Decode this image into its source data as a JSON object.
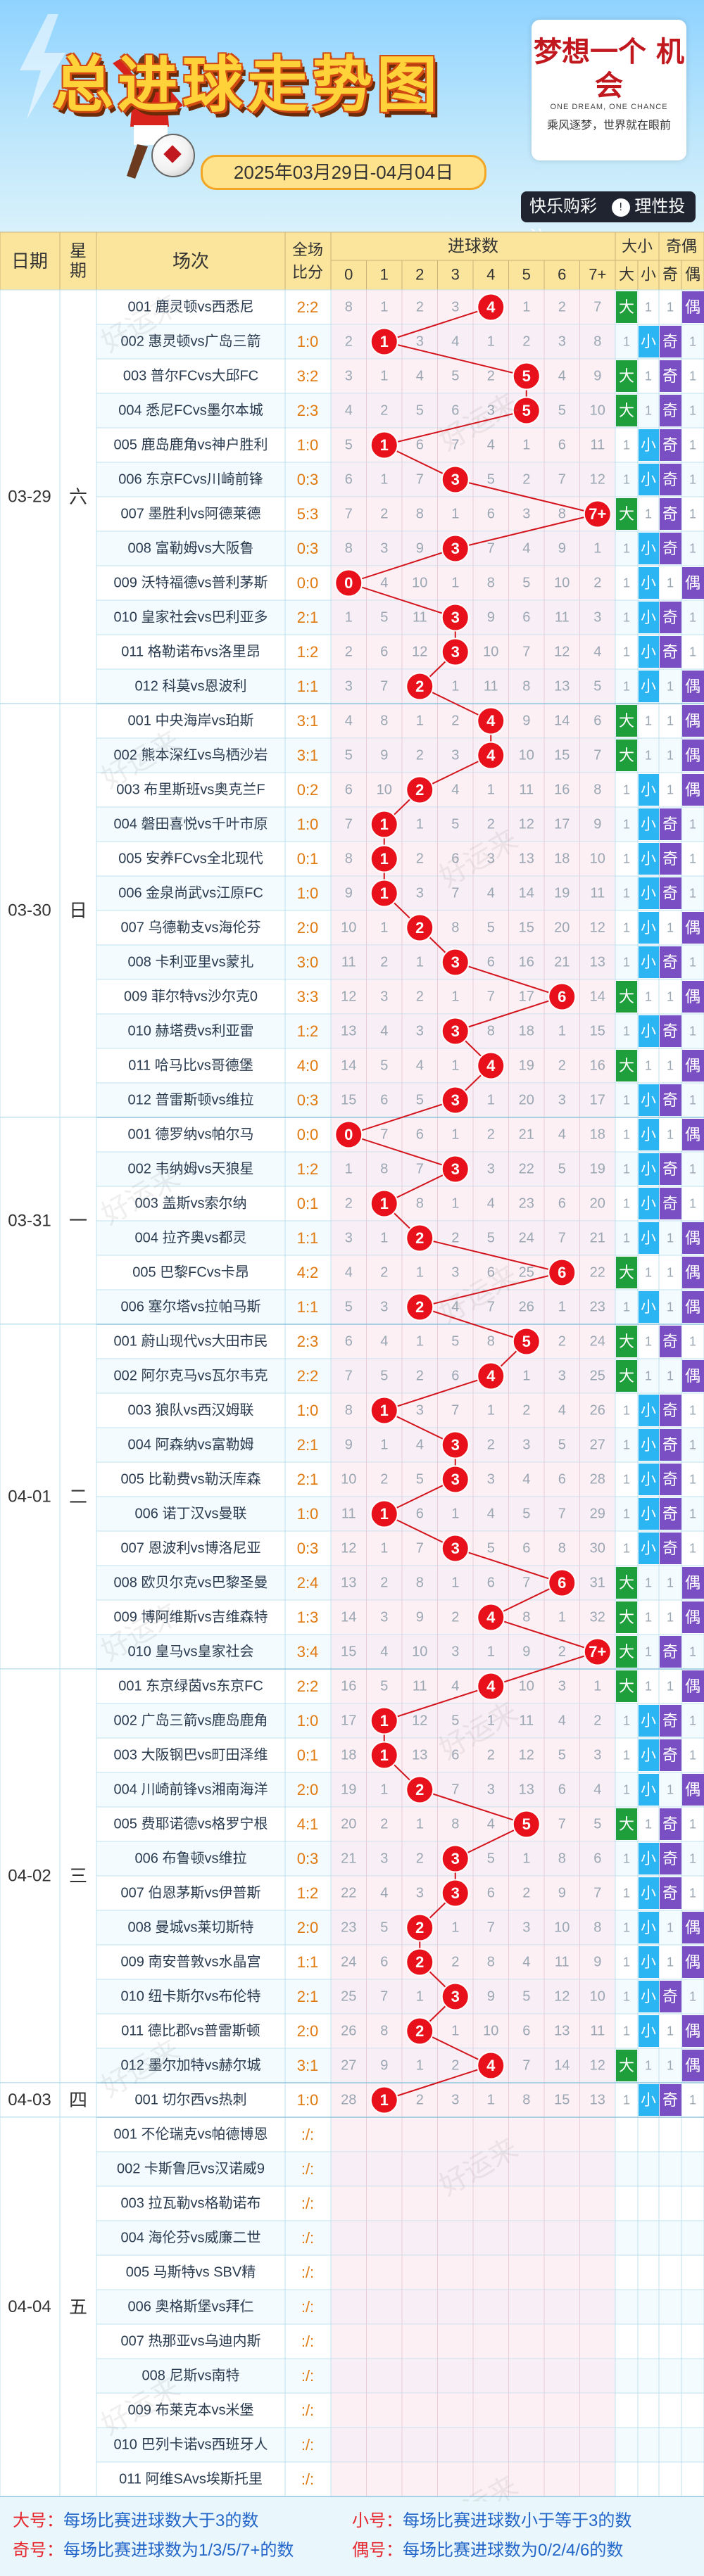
{
  "banner": {
    "title": "总进球走势图",
    "date_range": "2025年03月29日-04月04日",
    "slogan_main": "梦想一个 机会",
    "slogan_en": "ONE DREAM, ONE CHANCE",
    "slogan_cn": "乘风逐梦，世界就在眼前",
    "brand_1": "快乐购彩",
    "brand_2": "理性投注",
    "brand_icon": "!"
  },
  "header": {
    "date": "日期",
    "weekday": "星期",
    "match": "场次",
    "score_top": "全场",
    "score_bottom": "比分",
    "goals": "进球数",
    "goal_cols": [
      "0",
      "1",
      "2",
      "3",
      "4",
      "5",
      "6",
      "7+"
    ],
    "bigsmall": "大小",
    "big": "大",
    "small": "小",
    "oddeven": "奇偶",
    "odd": "奇",
    "even": "偶"
  },
  "watermark": "好运来",
  "colors": {
    "header_bg": "#fbe59c",
    "big": "#1f9e3c",
    "small": "#2bb5f2",
    "odd": "#7a4fc4",
    "even": "#7a4fc4",
    "ball": "#e8101a",
    "line": "#d4141c",
    "tint": "#fbe3ec"
  },
  "chart_data": {
    "type": "table",
    "days": [
      {
        "date": "03-29",
        "weekday": "六",
        "matches": [
          {
            "name": "001 鹿灵顿vs西悉尼",
            "score": "2:2",
            "goals": 4,
            "omit": [
              8,
              1,
              2,
              3,
              null,
              1,
              2,
              7
            ]
          },
          {
            "name": "002 惠灵顿vs广岛三箭",
            "score": "1:0",
            "goals": 1,
            "omit": [
              2,
              null,
              3,
              4,
              1,
              2,
              3,
              8
            ]
          },
          {
            "name": "003 普尔FCvs大邱FC",
            "score": "3:2",
            "goals": 5,
            "omit": [
              3,
              1,
              4,
              5,
              2,
              null,
              4,
              9
            ]
          },
          {
            "name": "004 悉尼FCvs墨尔本城",
            "score": "2:3",
            "goals": 5,
            "omit": [
              4,
              2,
              5,
              6,
              3,
              null,
              5,
              10
            ]
          },
          {
            "name": "005 鹿岛鹿角vs神户胜利",
            "score": "1:0",
            "goals": 1,
            "omit": [
              5,
              null,
              6,
              7,
              4,
              1,
              6,
              11
            ]
          },
          {
            "name": "006 东京FCvs川崎前锋",
            "score": "0:3",
            "goals": 3,
            "omit": [
              6,
              1,
              7,
              null,
              5,
              2,
              7,
              12
            ]
          },
          {
            "name": "007 墨胜利vs阿德莱德",
            "score": "5:3",
            "goals": 7,
            "omit": [
              7,
              2,
              8,
              1,
              6,
              3,
              8,
              null
            ]
          },
          {
            "name": "008 富勒姆vs大阪鲁",
            "score": "0:3",
            "goals": 3,
            "omit": [
              8,
              3,
              9,
              null,
              7,
              4,
              9,
              1
            ]
          },
          {
            "name": "009 沃特福德vs普利茅斯",
            "score": "0:0",
            "goals": 0,
            "omit": [
              null,
              4,
              10,
              1,
              8,
              5,
              10,
              2
            ]
          },
          {
            "name": "010 皇家社会vs巴利亚多",
            "score": "2:1",
            "goals": 3,
            "omit": [
              1,
              5,
              11,
              null,
              9,
              6,
              11,
              3
            ]
          },
          {
            "name": "011 格勒诺布vs洛里昂",
            "score": "1:2",
            "goals": 3,
            "omit": [
              2,
              6,
              12,
              null,
              10,
              7,
              12,
              4
            ]
          },
          {
            "name": "012 科莫vs恩波利",
            "score": "1:1",
            "goals": 2,
            "omit": [
              3,
              7,
              null,
              1,
              11,
              8,
              13,
              5
            ]
          }
        ]
      },
      {
        "date": "03-30",
        "weekday": "日",
        "matches": [
          {
            "name": "001 中央海岸vs珀斯",
            "score": "3:1",
            "goals": 4,
            "omit": [
              4,
              8,
              1,
              2,
              null,
              9,
              14,
              6
            ]
          },
          {
            "name": "002 熊本深红vs鸟栖沙岩",
            "score": "3:1",
            "goals": 4,
            "omit": [
              5,
              9,
              2,
              3,
              null,
              10,
              15,
              7
            ]
          },
          {
            "name": "003 布里斯班vs奥克兰F",
            "score": "0:2",
            "goals": 2,
            "omit": [
              6,
              10,
              null,
              4,
              1,
              11,
              16,
              8
            ]
          },
          {
            "name": "004 磐田喜悦vs千叶市原",
            "score": "1:0",
            "goals": 1,
            "omit": [
              7,
              null,
              1,
              5,
              2,
              12,
              17,
              9
            ]
          },
          {
            "name": "005 安养FCvs全北现代",
            "score": "0:1",
            "goals": 1,
            "omit": [
              8,
              null,
              2,
              6,
              3,
              13,
              18,
              10
            ]
          },
          {
            "name": "006 金泉尚武vs江原FC",
            "score": "1:0",
            "goals": 1,
            "omit": [
              9,
              null,
              3,
              7,
              4,
              14,
              19,
              11
            ]
          },
          {
            "name": "007 乌德勒支vs海伦芬",
            "score": "2:0",
            "goals": 2,
            "omit": [
              10,
              1,
              null,
              8,
              5,
              15,
              20,
              12
            ]
          },
          {
            "name": "008 卡利亚里vs蒙扎",
            "score": "3:0",
            "goals": 3,
            "omit": [
              11,
              2,
              1,
              null,
              6,
              16,
              21,
              13
            ]
          },
          {
            "name": "009 菲尔特vs沙尔克0",
            "score": "3:3",
            "goals": 6,
            "omit": [
              12,
              3,
              2,
              1,
              7,
              17,
              null,
              14
            ]
          },
          {
            "name": "010 赫塔费vs利亚雷",
            "score": "1:2",
            "goals": 3,
            "omit": [
              13,
              4,
              3,
              null,
              8,
              18,
              1,
              15
            ]
          },
          {
            "name": "011 哈马比vs哥德堡",
            "score": "4:0",
            "goals": 4,
            "omit": [
              14,
              5,
              4,
              1,
              null,
              19,
              2,
              16
            ]
          },
          {
            "name": "012 普雷斯顿vs维拉",
            "score": "0:3",
            "goals": 3,
            "omit": [
              15,
              6,
              5,
              null,
              1,
              20,
              3,
              17
            ]
          }
        ]
      },
      {
        "date": "03-31",
        "weekday": "一",
        "matches": [
          {
            "name": "001 德罗纳vs帕尔马",
            "score": "0:0",
            "goals": 0,
            "omit": [
              null,
              7,
              6,
              1,
              2,
              21,
              4,
              18
            ]
          },
          {
            "name": "002 韦纳姆vs天狼星",
            "score": "1:2",
            "goals": 3,
            "omit": [
              1,
              8,
              7,
              null,
              3,
              22,
              5,
              19
            ]
          },
          {
            "name": "003 盖斯vs索尔纳",
            "score": "0:1",
            "goals": 1,
            "omit": [
              2,
              null,
              8,
              1,
              4,
              23,
              6,
              20
            ]
          },
          {
            "name": "004 拉齐奥vs都灵",
            "score": "1:1",
            "goals": 2,
            "omit": [
              3,
              1,
              null,
              2,
              5,
              24,
              7,
              21
            ]
          },
          {
            "name": "005 巴黎FCvs卡昂",
            "score": "4:2",
            "goals": 6,
            "omit": [
              4,
              2,
              1,
              3,
              6,
              25,
              null,
              22
            ]
          },
          {
            "name": "006 塞尔塔vs拉帕马斯",
            "score": "1:1",
            "goals": 2,
            "omit": [
              5,
              3,
              null,
              4,
              7,
              26,
              1,
              23
            ]
          }
        ]
      },
      {
        "date": "04-01",
        "weekday": "二",
        "matches": [
          {
            "name": "001 蔚山现代vs大田市民",
            "score": "2:3",
            "goals": 5,
            "omit": [
              6,
              4,
              1,
              5,
              8,
              null,
              2,
              24
            ]
          },
          {
            "name": "002 阿尔克马vs瓦尔韦克",
            "score": "2:2",
            "goals": 4,
            "omit": [
              7,
              5,
              2,
              6,
              null,
              1,
              3,
              25
            ]
          },
          {
            "name": "003 狼队vs西汉姆联",
            "score": "1:0",
            "goals": 1,
            "omit": [
              8,
              null,
              3,
              7,
              1,
              2,
              4,
              26
            ]
          },
          {
            "name": "004 阿森纳vs富勒姆",
            "score": "2:1",
            "goals": 3,
            "omit": [
              9,
              1,
              4,
              null,
              2,
              3,
              5,
              27
            ]
          },
          {
            "name": "005 比勒费vs勒沃库森",
            "score": "2:1",
            "goals": 3,
            "omit": [
              10,
              2,
              5,
              null,
              3,
              4,
              6,
              28
            ]
          },
          {
            "name": "006 诺丁汉vs曼联",
            "score": "1:0",
            "goals": 1,
            "omit": [
              11,
              null,
              6,
              1,
              4,
              5,
              7,
              29
            ]
          },
          {
            "name": "007 恩波利vs博洛尼亚",
            "score": "0:3",
            "goals": 3,
            "omit": [
              12,
              1,
              7,
              null,
              5,
              6,
              8,
              30
            ]
          },
          {
            "name": "008 欧贝尔克vs巴黎圣曼",
            "score": "2:4",
            "goals": 6,
            "omit": [
              13,
              2,
              8,
              1,
              6,
              7,
              null,
              31
            ]
          },
          {
            "name": "009 博阿维斯vs吉维森特",
            "score": "1:3",
            "goals": 4,
            "omit": [
              14,
              3,
              9,
              2,
              null,
              8,
              1,
              32
            ]
          },
          {
            "name": "010 皇马vs皇家社会",
            "score": "3:4",
            "goals": 7,
            "omit": [
              15,
              4,
              10,
              3,
              1,
              9,
              2,
              null
            ]
          }
        ]
      },
      {
        "date": "04-02",
        "weekday": "三",
        "matches": [
          {
            "name": "001 东京绿茵vs东京FC",
            "score": "2:2",
            "goals": 4,
            "omit": [
              16,
              5,
              11,
              4,
              null,
              10,
              3,
              1
            ]
          },
          {
            "name": "002 广岛三箭vs鹿岛鹿角",
            "score": "1:0",
            "goals": 1,
            "omit": [
              17,
              null,
              12,
              5,
              1,
              11,
              4,
              2
            ]
          },
          {
            "name": "003 大阪钢巴vs町田泽维",
            "score": "0:1",
            "goals": 1,
            "omit": [
              18,
              null,
              13,
              6,
              2,
              12,
              5,
              3
            ]
          },
          {
            "name": "004 川崎前锋vs湘南海洋",
            "score": "2:0",
            "goals": 2,
            "omit": [
              19,
              1,
              null,
              7,
              3,
              13,
              6,
              4
            ]
          },
          {
            "name": "005 费耶诺德vs格罗宁根",
            "score": "4:1",
            "goals": 5,
            "omit": [
              20,
              2,
              1,
              8,
              4,
              null,
              7,
              5
            ]
          },
          {
            "name": "006 布鲁顿vs维拉",
            "score": "0:3",
            "goals": 3,
            "omit": [
              21,
              3,
              2,
              null,
              5,
              1,
              8,
              6
            ]
          },
          {
            "name": "007 伯恩茅斯vs伊普斯",
            "score": "1:2",
            "goals": 3,
            "omit": [
              22,
              4,
              3,
              null,
              6,
              2,
              9,
              7
            ]
          },
          {
            "name": "008 曼城vs莱切斯特",
            "score": "2:0",
            "goals": 2,
            "omit": [
              23,
              5,
              null,
              1,
              7,
              3,
              10,
              8
            ]
          },
          {
            "name": "009 南安普敦vs水晶宫",
            "score": "1:1",
            "goals": 2,
            "omit": [
              24,
              6,
              null,
              2,
              8,
              4,
              11,
              9
            ]
          },
          {
            "name": "010 纽卡斯尔vs布伦特",
            "score": "2:1",
            "goals": 3,
            "omit": [
              25,
              7,
              1,
              null,
              9,
              5,
              12,
              10
            ]
          },
          {
            "name": "011 德比郡vs普雷斯顿",
            "score": "2:0",
            "goals": 2,
            "omit": [
              26,
              8,
              null,
              1,
              10,
              6,
              13,
              11
            ]
          },
          {
            "name": "012 墨尔加特vs赫尔城",
            "score": "3:1",
            "goals": 4,
            "omit": [
              27,
              9,
              1,
              2,
              null,
              7,
              14,
              12
            ]
          }
        ]
      },
      {
        "date": "04-03",
        "weekday": "四",
        "matches": [
          {
            "name": "001 切尔西vs热刺",
            "score": "1:0",
            "goals": 1,
            "omit": [
              28,
              null,
              2,
              3,
              1,
              8,
              15,
              13
            ]
          }
        ]
      },
      {
        "date": "04-04",
        "weekday": "五",
        "matches": [
          {
            "name": "001 不伦瑞克vs帕德博恩",
            "score": ":/:"
          },
          {
            "name": "002 卡斯鲁厄vs汉诺威9",
            "score": ":/:"
          },
          {
            "name": "003 拉瓦勒vs格勒诺布",
            "score": ":/:"
          },
          {
            "name": "004 海伦芬vs威廉二世",
            "score": ":/:"
          },
          {
            "name": "005 马斯特vs SBV精",
            "score": ":/:"
          },
          {
            "name": "006 奥格斯堡vs拜仁",
            "score": ":/:"
          },
          {
            "name": "007 热那亚vs乌迪内斯",
            "score": ":/:"
          },
          {
            "name": "008 尼斯vs南特",
            "score": ":/:"
          },
          {
            "name": "009 布莱克本vs米堡",
            "score": ":/:"
          },
          {
            "name": "010 巴列卡诺vs西班牙人",
            "score": ":/:"
          },
          {
            "name": "011 阿维SAvs埃斯托里",
            "score": ":/:"
          }
        ]
      }
    ]
  },
  "footer": {
    "big_key": "大号：",
    "big_desc": "每场比赛进球数大于3的数",
    "small_key": "小号：",
    "small_desc": "每场比赛进球数小于等于3的数",
    "odd_key": "奇号：",
    "odd_desc": "每场比赛进球数为1/3/5/7+的数",
    "even_key": "偶号：",
    "even_desc": "每场比赛进球数为0/2/4/6的数"
  }
}
